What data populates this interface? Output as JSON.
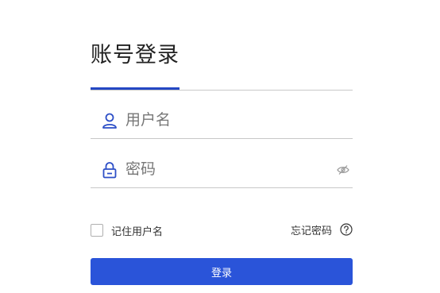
{
  "login": {
    "title": "账号登录",
    "username_placeholder": "用户名",
    "password_placeholder": "密码",
    "remember_label": "记住用户名",
    "forgot_label": "忘记密码",
    "submit_label": "登录"
  },
  "icons": {
    "username": "user-icon",
    "password": "lock-icon",
    "visibility": "eye-icon",
    "help": "question-circle-icon"
  },
  "colors": {
    "accent": "#2448c4",
    "button": "#2a54d9",
    "icon": "#2d4fc7"
  }
}
